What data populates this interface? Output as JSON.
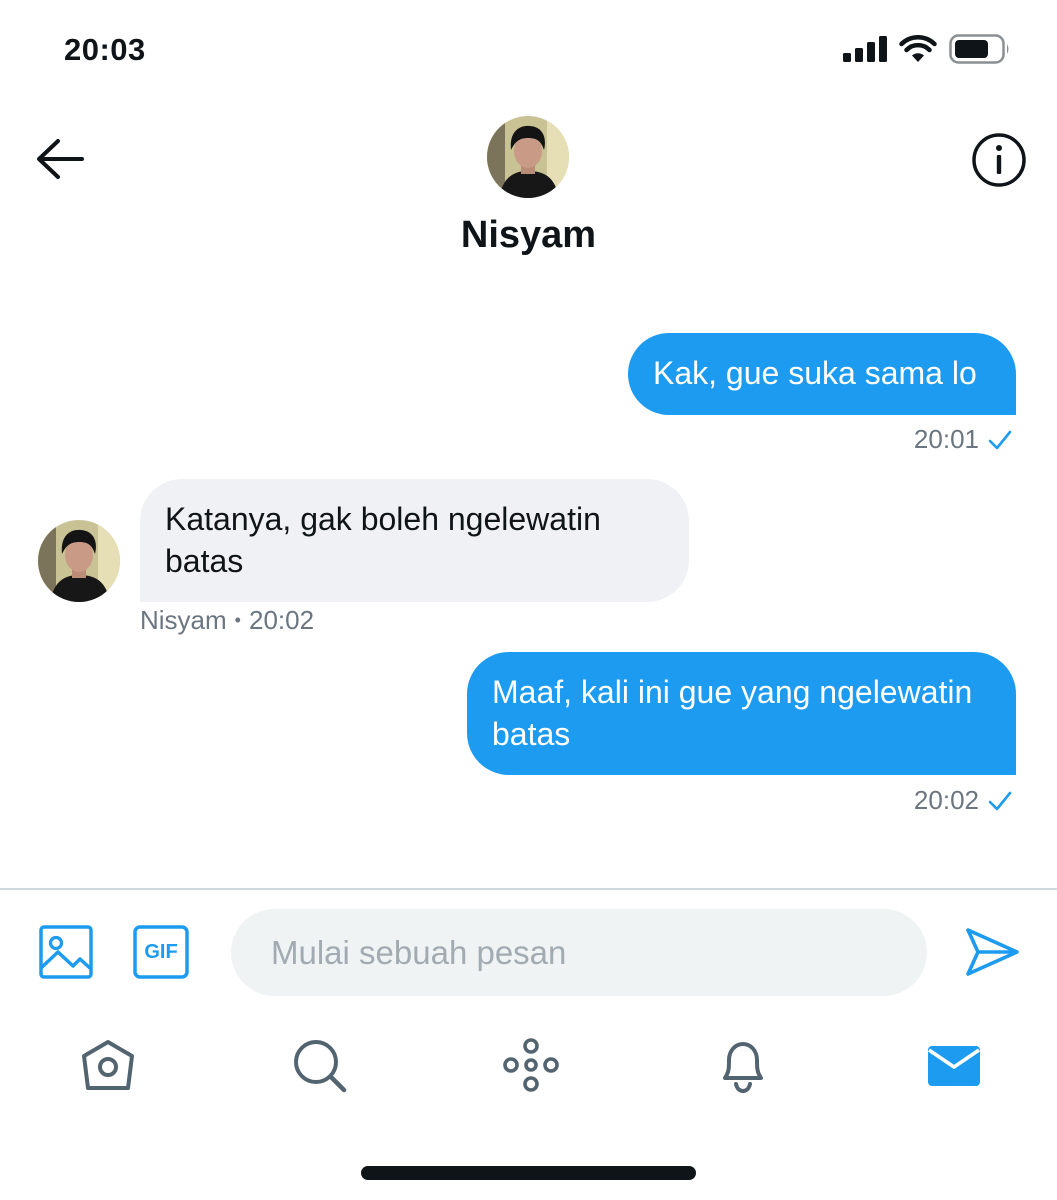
{
  "status_bar": {
    "time": "20:03",
    "icons": [
      "cellular-signal-icon",
      "wifi-icon",
      "battery-icon"
    ]
  },
  "header": {
    "contact_name": "Nisyam",
    "back_icon": "arrow-left-icon",
    "info_icon": "info-circle-icon"
  },
  "messages": [
    {
      "direction": "outgoing",
      "text": "Kak, gue suka sama lo",
      "time": "20:01",
      "status_icon": "checkmark-icon"
    },
    {
      "direction": "incoming",
      "text": "Katanya, gak boleh ngelewatin batas",
      "sender": "Nisyam",
      "separator": "•",
      "time": "20:02"
    },
    {
      "direction": "outgoing",
      "text": "Maaf, kali ini gue yang ngelewatin batas",
      "time": "20:02",
      "status_icon": "checkmark-icon"
    }
  ],
  "composer": {
    "placeholder": "Mulai sebuah pesan",
    "value": "",
    "gif_label": "GIF",
    "icons": [
      "image-icon",
      "gif-icon",
      "send-icon"
    ]
  },
  "tab_bar": {
    "items": [
      "home-icon",
      "search-icon",
      "spaces-icon",
      "notifications-bell-icon",
      "messages-envelope-icon"
    ],
    "active": "messages-envelope-icon"
  },
  "colors": {
    "accent": "#1d9bf0",
    "incoming_bubble": "#eff1f4",
    "text": "#0f1419",
    "muted": "#6b7680",
    "icon_gray": "#536471"
  }
}
